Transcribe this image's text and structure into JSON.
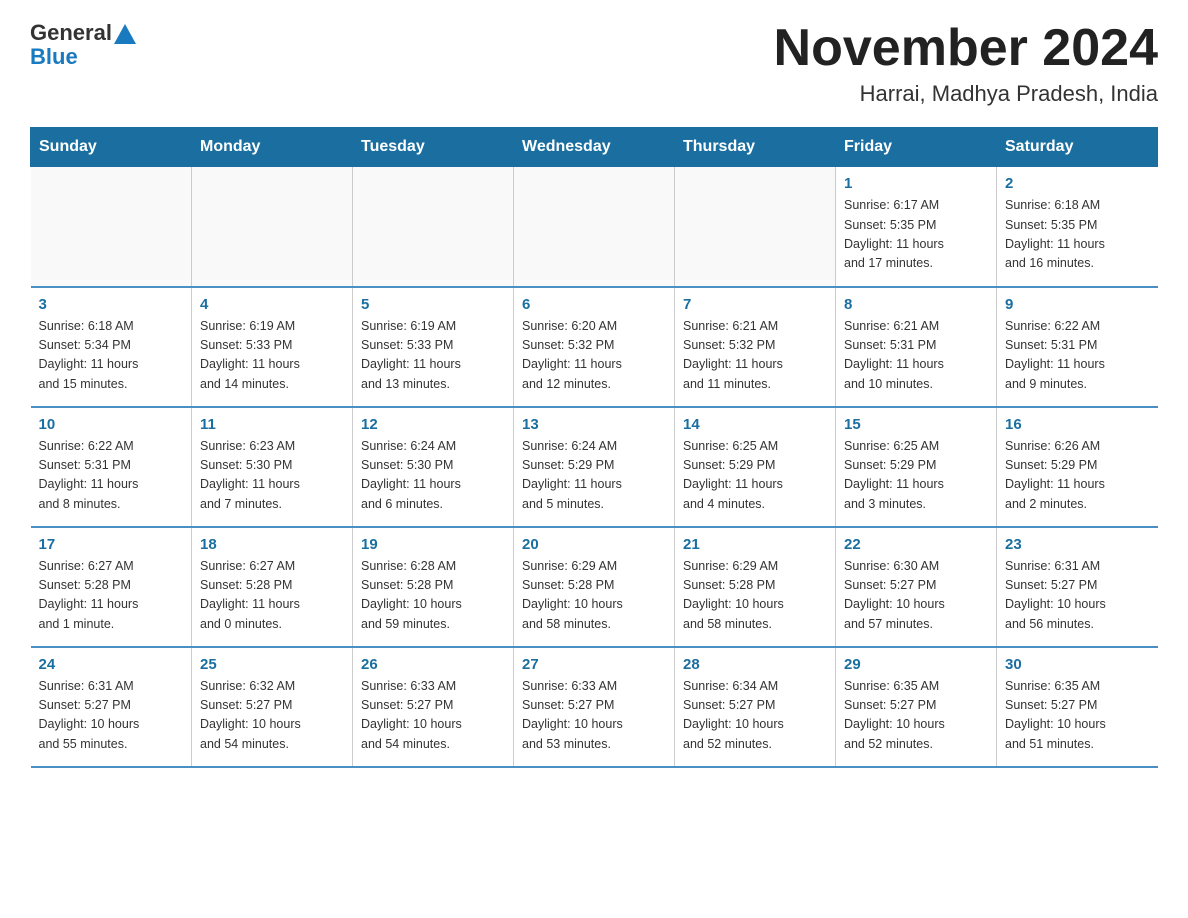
{
  "logo": {
    "general": "General",
    "blue": "Blue"
  },
  "header": {
    "month": "November 2024",
    "location": "Harrai, Madhya Pradesh, India"
  },
  "days_of_week": [
    "Sunday",
    "Monday",
    "Tuesday",
    "Wednesday",
    "Thursday",
    "Friday",
    "Saturday"
  ],
  "weeks": [
    [
      {
        "day": "",
        "info": ""
      },
      {
        "day": "",
        "info": ""
      },
      {
        "day": "",
        "info": ""
      },
      {
        "day": "",
        "info": ""
      },
      {
        "day": "",
        "info": ""
      },
      {
        "day": "1",
        "info": "Sunrise: 6:17 AM\nSunset: 5:35 PM\nDaylight: 11 hours\nand 17 minutes."
      },
      {
        "day": "2",
        "info": "Sunrise: 6:18 AM\nSunset: 5:35 PM\nDaylight: 11 hours\nand 16 minutes."
      }
    ],
    [
      {
        "day": "3",
        "info": "Sunrise: 6:18 AM\nSunset: 5:34 PM\nDaylight: 11 hours\nand 15 minutes."
      },
      {
        "day": "4",
        "info": "Sunrise: 6:19 AM\nSunset: 5:33 PM\nDaylight: 11 hours\nand 14 minutes."
      },
      {
        "day": "5",
        "info": "Sunrise: 6:19 AM\nSunset: 5:33 PM\nDaylight: 11 hours\nand 13 minutes."
      },
      {
        "day": "6",
        "info": "Sunrise: 6:20 AM\nSunset: 5:32 PM\nDaylight: 11 hours\nand 12 minutes."
      },
      {
        "day": "7",
        "info": "Sunrise: 6:21 AM\nSunset: 5:32 PM\nDaylight: 11 hours\nand 11 minutes."
      },
      {
        "day": "8",
        "info": "Sunrise: 6:21 AM\nSunset: 5:31 PM\nDaylight: 11 hours\nand 10 minutes."
      },
      {
        "day": "9",
        "info": "Sunrise: 6:22 AM\nSunset: 5:31 PM\nDaylight: 11 hours\nand 9 minutes."
      }
    ],
    [
      {
        "day": "10",
        "info": "Sunrise: 6:22 AM\nSunset: 5:31 PM\nDaylight: 11 hours\nand 8 minutes."
      },
      {
        "day": "11",
        "info": "Sunrise: 6:23 AM\nSunset: 5:30 PM\nDaylight: 11 hours\nand 7 minutes."
      },
      {
        "day": "12",
        "info": "Sunrise: 6:24 AM\nSunset: 5:30 PM\nDaylight: 11 hours\nand 6 minutes."
      },
      {
        "day": "13",
        "info": "Sunrise: 6:24 AM\nSunset: 5:29 PM\nDaylight: 11 hours\nand 5 minutes."
      },
      {
        "day": "14",
        "info": "Sunrise: 6:25 AM\nSunset: 5:29 PM\nDaylight: 11 hours\nand 4 minutes."
      },
      {
        "day": "15",
        "info": "Sunrise: 6:25 AM\nSunset: 5:29 PM\nDaylight: 11 hours\nand 3 minutes."
      },
      {
        "day": "16",
        "info": "Sunrise: 6:26 AM\nSunset: 5:29 PM\nDaylight: 11 hours\nand 2 minutes."
      }
    ],
    [
      {
        "day": "17",
        "info": "Sunrise: 6:27 AM\nSunset: 5:28 PM\nDaylight: 11 hours\nand 1 minute."
      },
      {
        "day": "18",
        "info": "Sunrise: 6:27 AM\nSunset: 5:28 PM\nDaylight: 11 hours\nand 0 minutes."
      },
      {
        "day": "19",
        "info": "Sunrise: 6:28 AM\nSunset: 5:28 PM\nDaylight: 10 hours\nand 59 minutes."
      },
      {
        "day": "20",
        "info": "Sunrise: 6:29 AM\nSunset: 5:28 PM\nDaylight: 10 hours\nand 58 minutes."
      },
      {
        "day": "21",
        "info": "Sunrise: 6:29 AM\nSunset: 5:28 PM\nDaylight: 10 hours\nand 58 minutes."
      },
      {
        "day": "22",
        "info": "Sunrise: 6:30 AM\nSunset: 5:27 PM\nDaylight: 10 hours\nand 57 minutes."
      },
      {
        "day": "23",
        "info": "Sunrise: 6:31 AM\nSunset: 5:27 PM\nDaylight: 10 hours\nand 56 minutes."
      }
    ],
    [
      {
        "day": "24",
        "info": "Sunrise: 6:31 AM\nSunset: 5:27 PM\nDaylight: 10 hours\nand 55 minutes."
      },
      {
        "day": "25",
        "info": "Sunrise: 6:32 AM\nSunset: 5:27 PM\nDaylight: 10 hours\nand 54 minutes."
      },
      {
        "day": "26",
        "info": "Sunrise: 6:33 AM\nSunset: 5:27 PM\nDaylight: 10 hours\nand 54 minutes."
      },
      {
        "day": "27",
        "info": "Sunrise: 6:33 AM\nSunset: 5:27 PM\nDaylight: 10 hours\nand 53 minutes."
      },
      {
        "day": "28",
        "info": "Sunrise: 6:34 AM\nSunset: 5:27 PM\nDaylight: 10 hours\nand 52 minutes."
      },
      {
        "day": "29",
        "info": "Sunrise: 6:35 AM\nSunset: 5:27 PM\nDaylight: 10 hours\nand 52 minutes."
      },
      {
        "day": "30",
        "info": "Sunrise: 6:35 AM\nSunset: 5:27 PM\nDaylight: 10 hours\nand 51 minutes."
      }
    ]
  ]
}
